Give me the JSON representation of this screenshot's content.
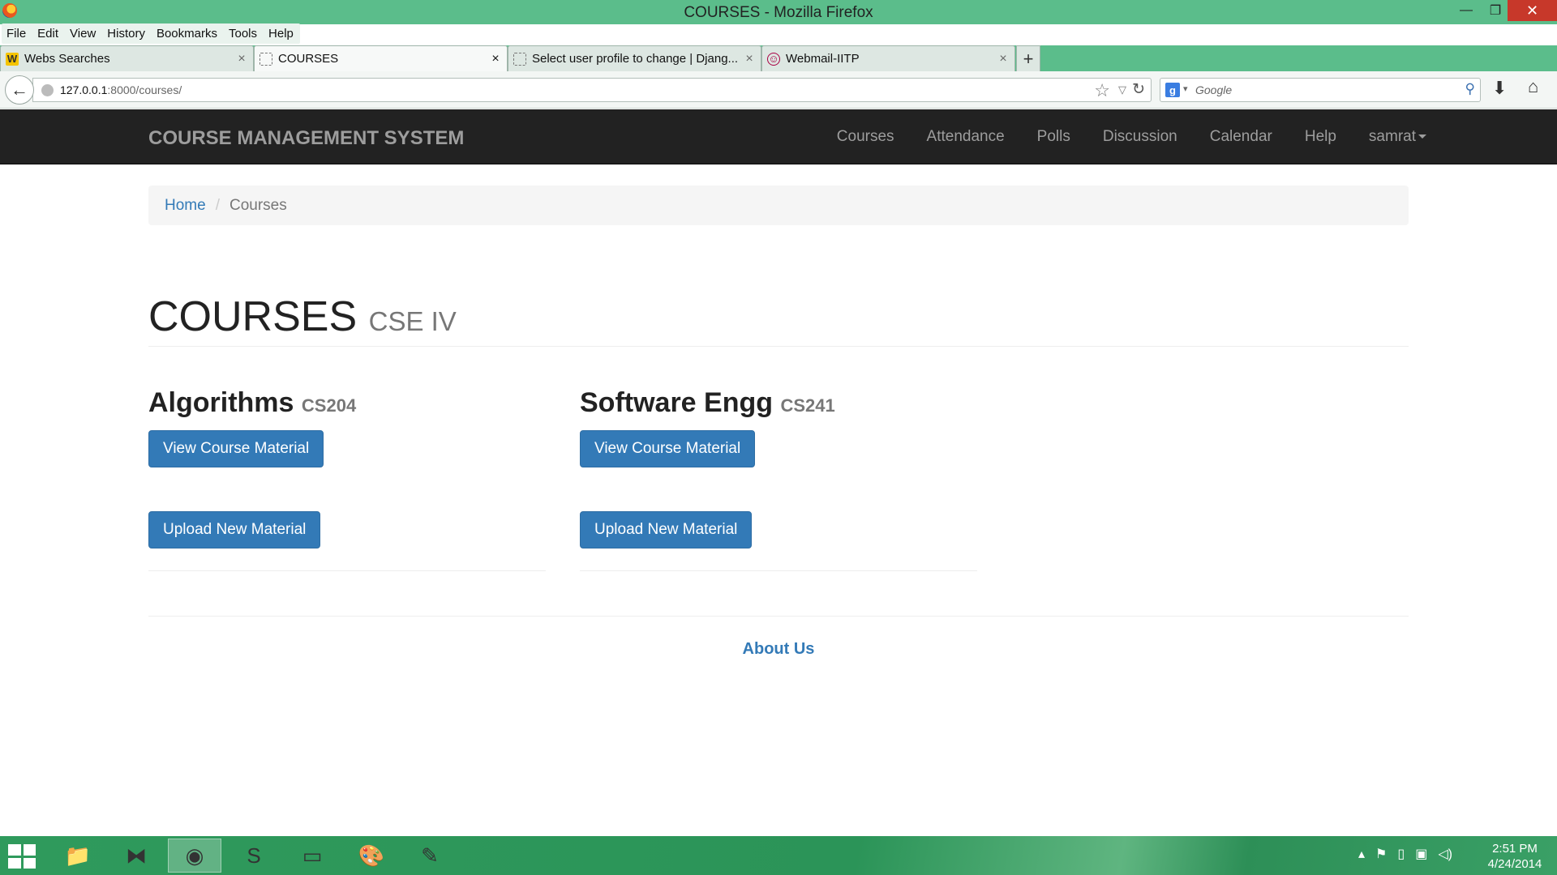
{
  "window": {
    "title": "COURSES - Mozilla Firefox",
    "controls": {
      "minimize": "—",
      "maximize": "❐",
      "close": "✕"
    }
  },
  "menu": [
    "File",
    "Edit",
    "View",
    "History",
    "Bookmarks",
    "Tools",
    "Help"
  ],
  "tabs": [
    {
      "label": "Webs Searches",
      "icon": "w-icon",
      "icon_text": "W",
      "active": false
    },
    {
      "label": "COURSES",
      "icon": "blank-page-icon",
      "active": true
    },
    {
      "label": "Select user profile to change | Djang...",
      "icon": "blank-page-icon",
      "active": false
    },
    {
      "label": "Webmail-IITP",
      "icon": "mail-icon",
      "active": false
    }
  ],
  "tab_close": "×",
  "new_tab": "+",
  "nav": {
    "url_host": "127.0.0.1",
    "url_rest": ":8000/courses/",
    "search_placeholder": "Google",
    "search_logo": "g"
  },
  "site": {
    "brand": "COURSE MANAGEMENT SYSTEM",
    "nav_items": [
      "Courses",
      "Attendance",
      "Polls",
      "Discussion",
      "Calendar",
      "Help"
    ],
    "user": "samrat",
    "breadcrumb": {
      "home": "Home",
      "separator": "/",
      "current": "Courses"
    },
    "page_title": "COURSES",
    "page_subtitle": "CSE IV",
    "courses": [
      {
        "name": "Algorithms",
        "code": "CS204",
        "view_label": "View Course Material",
        "upload_label": "Upload New Material"
      },
      {
        "name": "Software Engg",
        "code": "CS241",
        "view_label": "View Course Material",
        "upload_label": "Upload New Material"
      }
    ],
    "footer_link": "About Us"
  },
  "taskbar": {
    "apps": [
      "file-explorer-icon",
      "visual-studio-icon",
      "firefox-icon",
      "sublime-text-icon",
      "command-prompt-icon",
      "paint-icon",
      "notepad-icon"
    ],
    "time": "2:51 PM",
    "date": "4/24/2014"
  },
  "colors": {
    "chrome_green": "#5bbd8b",
    "navbar_dark": "#222222",
    "primary_blue": "#337ab7",
    "close_red": "#c7382a"
  }
}
